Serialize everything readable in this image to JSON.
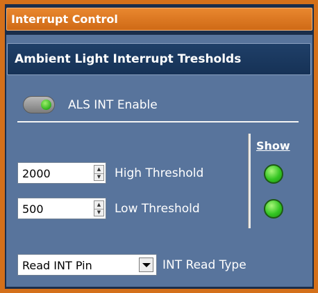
{
  "panel": {
    "title": "Interrupt Control",
    "section_title": "Ambient Light Interrupt Tresholds"
  },
  "als": {
    "enable_label": "ALS INT Enable",
    "enabled": true
  },
  "thresholds": {
    "show_label": "Show",
    "high": {
      "value": "2000",
      "label": "High Threshold",
      "indicator_on": true
    },
    "low": {
      "value": "500",
      "label": "Low Threshold",
      "indicator_on": true
    }
  },
  "read_type": {
    "selected": "Read INT Pin",
    "label": "INT Read Type"
  },
  "colors": {
    "accent_orange": "#d4701a",
    "panel_blue": "#58749c",
    "header_blue": "#1f3f68",
    "led_green": "#33c522"
  },
  "icons": {
    "spinner": "up-down-arrows-icon",
    "dropdown": "chevron-down-icon"
  }
}
